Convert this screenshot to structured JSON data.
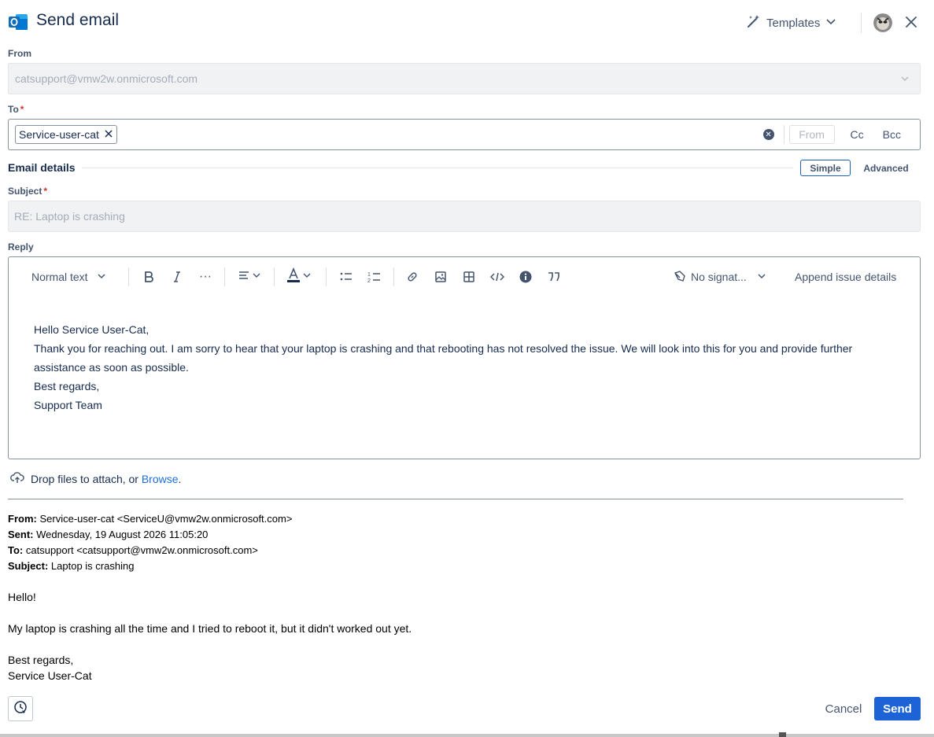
{
  "header": {
    "title": "Send email",
    "templates_label": "Templates"
  },
  "from": {
    "label": "From",
    "value": "catsupport@vmw2w.onmicrosoft.com"
  },
  "to": {
    "label": "To",
    "required_mark": "*",
    "recipients": [
      "Service-user-cat"
    ],
    "from_toggle": "From",
    "cc_label": "Cc",
    "bcc_label": "Bcc"
  },
  "email_details": {
    "title": "Email details",
    "mode_simple": "Simple",
    "mode_advanced": "Advanced"
  },
  "subject": {
    "label": "Subject",
    "required_mark": "*",
    "value": "RE: Laptop is crashing"
  },
  "reply": {
    "label": "Reply",
    "toolbar": {
      "text_style": "Normal text",
      "signature": "No signat...",
      "append_issue": "Append issue details"
    },
    "body_lines": [
      "Hello Service User-Cat,",
      "Thank you for reaching out. I am sorry to hear that your laptop is crashing and that rebooting has not resolved the issue. We will look into this for you and provide further assistance as soon as possible.",
      "Best regards,",
      "Support Team"
    ]
  },
  "attach": {
    "text": "Drop files to attach, or",
    "browse": "Browse",
    "period": "."
  },
  "quoted": {
    "from_label": "From:",
    "from_value": "Service-user-cat <ServiceU@vmw2w.onmicrosoft.com>",
    "sent_label": "Sent:",
    "sent_value": "Wednesday, 19 August 2026 11:05:20",
    "to_label": "To:",
    "to_value": "catsupport <catsupport@vmw2w.onmicrosoft.com>",
    "subject_label": "Subject:",
    "subject_value": "Laptop is crashing",
    "greeting": "Hello!",
    "message": "My laptop is crashing all the time and I tried to reboot it, but it didn't worked out yet.",
    "closing": "Best regards,",
    "signature": "Service User-Cat"
  },
  "footer": {
    "cancel_label": "Cancel",
    "send_label": "Send"
  },
  "colors": {
    "accent": "#1d63d6",
    "required": "#c9372c",
    "link": "#1d6fd6"
  }
}
